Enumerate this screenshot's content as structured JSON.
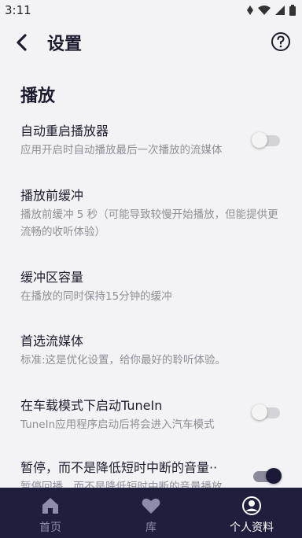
{
  "status_bar": {
    "time": "3:11"
  },
  "app_bar": {
    "title": "设置"
  },
  "section": {
    "title": "播放"
  },
  "settings": [
    {
      "label": "自动重启播放器",
      "desc": "应用开启时自动播放最后一次播放的流媒体",
      "toggle": "off"
    },
    {
      "label": "播放前缓冲",
      "desc": "播放前缓冲 5 秒（可能导致较慢开始播放，但能提供更流畅的收听体验）"
    },
    {
      "label": "缓冲区容量",
      "desc": "在播放的同时保持15分钟的缓冲"
    },
    {
      "label": "首选流媒体",
      "desc": "标准:这是优化设置，给你最好的聆听体验。"
    },
    {
      "label": "在车载模式下启动TuneIn",
      "desc": "TuneIn应用程序启动后将会进入汽车模式",
      "toggle": "off"
    },
    {
      "label": "暂停，而不是降低短时中断的音量··",
      "desc": "暂停回播，而不是降低短时中断的音量播放",
      "toggle": "on"
    }
  ],
  "bottom_nav": [
    {
      "label": "首页",
      "icon": "home-icon",
      "active": false
    },
    {
      "label": "库",
      "icon": "heart-icon",
      "active": false
    },
    {
      "label": "个人资料",
      "icon": "profile-icon",
      "active": true
    }
  ],
  "colors": {
    "nav_bg": "#1f1f3d",
    "toggle_on_thumb": "#1a1a36",
    "page_bg": "#f3f3f5"
  }
}
